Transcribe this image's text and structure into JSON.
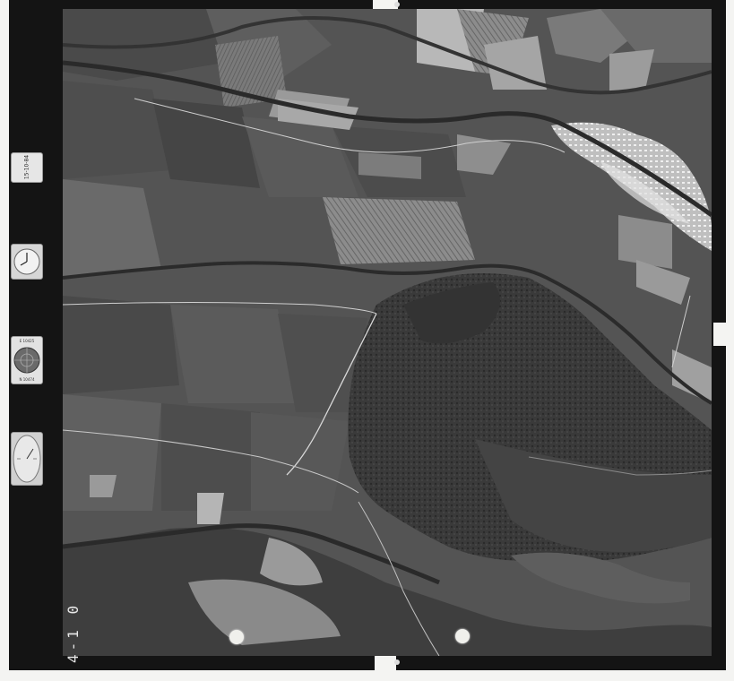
{
  "frame": {
    "number": "4-1 0",
    "date_label": "15-10-84",
    "level_top_text": "E 10425",
    "level_bottom_text": "N 10474"
  },
  "colors": {
    "film_border": "#141414",
    "paper": "#f4f4f2",
    "forest": "#2e2e2e",
    "fields": "#5c5c5c",
    "bright_fields": "#a6a6a6",
    "town": "#d8d8d8"
  },
  "scene": {
    "description_icons": [
      "clock-icon",
      "bubble-level-icon",
      "altimeter-icon"
    ]
  }
}
